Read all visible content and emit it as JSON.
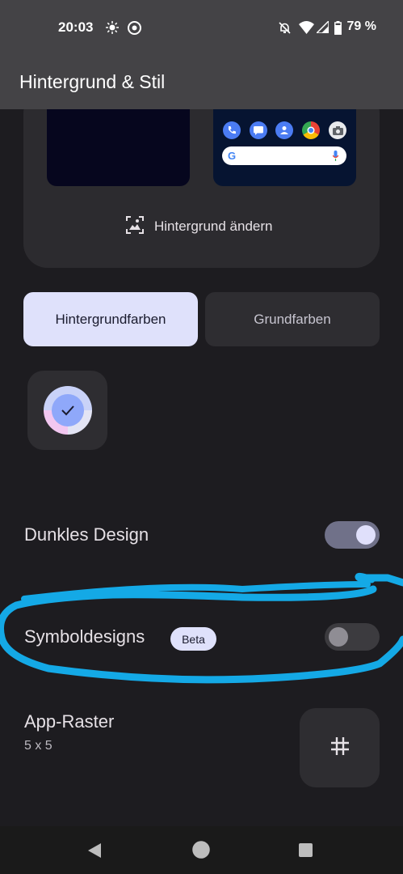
{
  "status_bar": {
    "time": "20:03",
    "battery_percent": "79 %",
    "icons": [
      "brightness-icon",
      "chrome-icon",
      "do-not-disturb-off-icon",
      "wifi-icon",
      "signal-icon",
      "battery-icon"
    ]
  },
  "app_bar": {
    "title": "Hintergrund & Stil"
  },
  "preview": {
    "change_wallpaper_label": "Hintergrund ändern",
    "home_icons": [
      "phone-icon",
      "messages-icon",
      "contacts-icon",
      "chrome-icon",
      "camera-icon"
    ]
  },
  "color_tabs": {
    "wallpaper_colors": "Hintergrundfarben",
    "basic_colors": "Grundfarben",
    "selected": "Hintergrundfarben"
  },
  "settings": {
    "dark_theme": {
      "label": "Dunkles Design",
      "enabled": true
    },
    "themed_icons": {
      "label": "Symboldesigns",
      "badge": "Beta",
      "enabled": false
    },
    "app_grid": {
      "label": "App-Raster",
      "value": "5 x 5"
    }
  },
  "colors": {
    "accent": "#dfe1fb",
    "annotation": "#14a9e6"
  }
}
